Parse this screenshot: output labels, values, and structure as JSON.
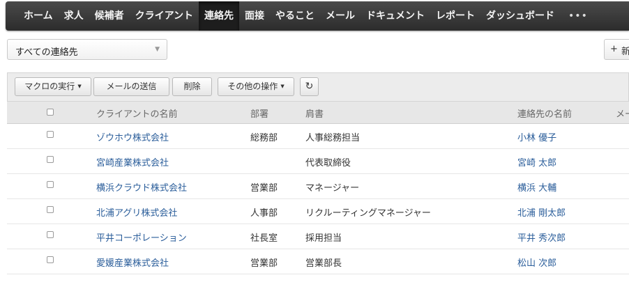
{
  "nav": {
    "items": [
      "ホーム",
      "求人",
      "候補者",
      "クライアント",
      "連絡先",
      "面接",
      "やること",
      "メール",
      "ドキュメント",
      "レポート",
      "ダッシュボード"
    ],
    "active_index": 4,
    "more_label": "•••"
  },
  "filter": {
    "selected": "すべての連絡先",
    "caret": "▼"
  },
  "new_button": {
    "icon": "+",
    "label": "新"
  },
  "toolbar": {
    "macro_label": "マクロの実行",
    "send_mail_label": "メールの送信",
    "delete_label": "削除",
    "more_ops_label": "その他の操作",
    "caret": "▼",
    "refresh_icon": "refresh-icon",
    "refresh_glyph": "↻"
  },
  "table": {
    "columns": [
      "クライアントの名前",
      "部署",
      "肩書",
      "連絡先の名前",
      "メー"
    ],
    "rows": [
      {
        "client": "ゾウホウ株式会社",
        "dept": "総務部",
        "title": "人事総務担当",
        "contact": "小林 優子"
      },
      {
        "client": "宮崎産業株式会社",
        "dept": "",
        "title": "代表取締役",
        "contact": "宮崎 太郎"
      },
      {
        "client": "横浜クラウド株式会社",
        "dept": "営業部",
        "title": "マネージャー",
        "contact": "横浜 大輔"
      },
      {
        "client": "北浦アグリ株式会社",
        "dept": "人事部",
        "title": "リクルーティングマネージャー",
        "contact": "北浦 剛太郎"
      },
      {
        "client": "平井コーポレーション",
        "dept": "社長室",
        "title": "採用担当",
        "contact": "平井 秀次郎"
      },
      {
        "client": "愛媛産業株式会社",
        "dept": "営業部",
        "title": "営業部長",
        "contact": "松山 次郎"
      }
    ]
  },
  "colors": {
    "nav_bg": "#333333",
    "link": "#2a5d9a",
    "header_bg": "#e7e7e7"
  }
}
